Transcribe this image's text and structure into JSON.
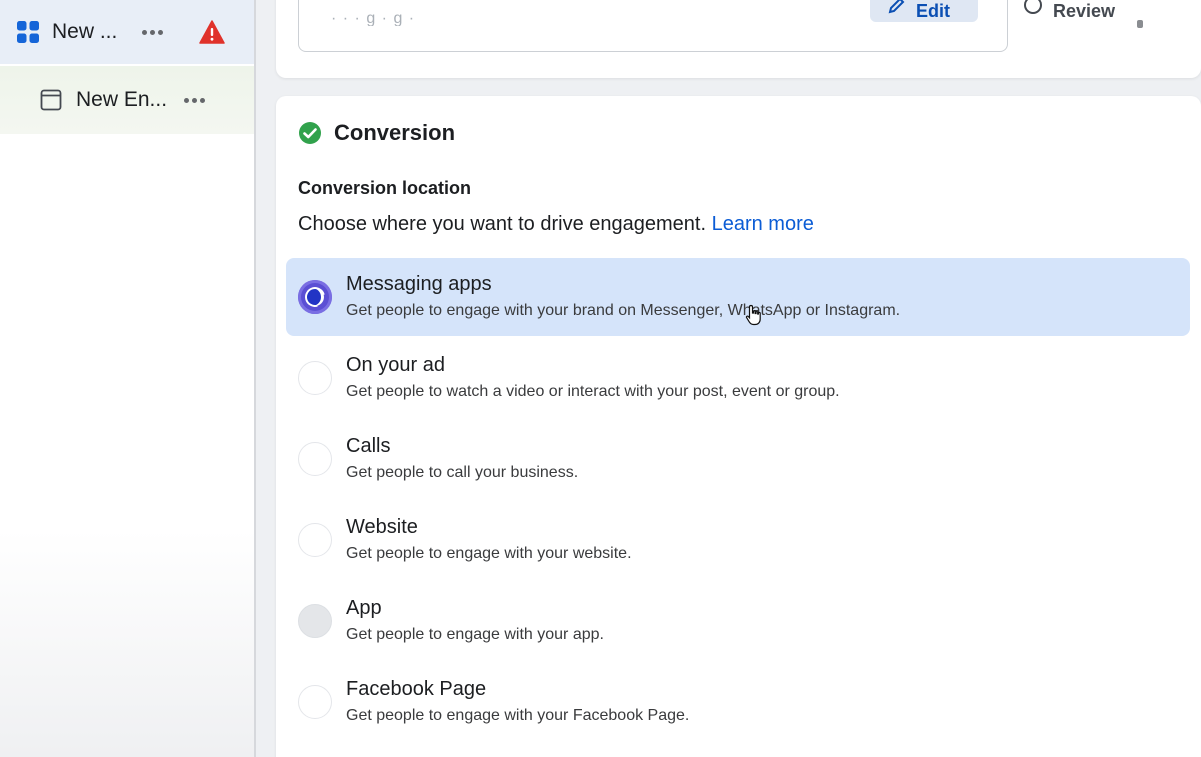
{
  "sidebar": {
    "campaign": {
      "label": "New ...",
      "icon": "grid-icon",
      "status_icon": "warning-icon"
    },
    "adset": {
      "label": "New En...",
      "icon": "page-icon"
    }
  },
  "header": {
    "edit_label": "Edit",
    "review_label": "Review"
  },
  "conversion": {
    "title": "Conversion",
    "location_title": "Conversion location",
    "location_desc": "Choose where you want to drive engagement.",
    "learn_more": "Learn more",
    "options": [
      {
        "title": "Messaging apps",
        "desc": "Get people to engage with your brand on Messenger, WhatsApp or Instagram.",
        "selected": true
      },
      {
        "title": "On your ad",
        "desc": "Get people to watch a video or interact with your post, event or group.",
        "selected": false
      },
      {
        "title": "Calls",
        "desc": "Get people to call your business.",
        "selected": false
      },
      {
        "title": "Website",
        "desc": "Get people to engage with your website.",
        "selected": false
      },
      {
        "title": "App",
        "desc": "Get people to engage with your app.",
        "selected": false,
        "disabled": true
      },
      {
        "title": "Facebook Page",
        "desc": "Get people to engage with your Facebook Page.",
        "selected": false
      }
    ]
  },
  "colors": {
    "accent": "#0b5cd5",
    "selected_bg": "#d5e4fa",
    "success": "#31a24c",
    "warning": "#e0322b"
  }
}
